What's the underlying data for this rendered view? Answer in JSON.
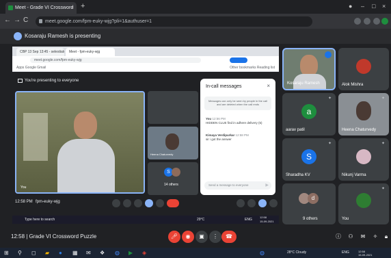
{
  "browser": {
    "tab_title": "Meet - Grade VI Crossword",
    "tab_close": "×",
    "new_tab": "+",
    "url": "meet.google.com/fpm-euky-wjg?pli=1&authuser=1",
    "back": "←",
    "forward": "→",
    "reload": "C",
    "min": "–",
    "max": "□",
    "close": "×"
  },
  "presenting_banner": "Kosaraju Ramesh is presenting",
  "shared_screen": {
    "tabs": [
      "CBP 13 Sep 13:45 - selestialcr...",
      "Meet - fpm-euky-wjg"
    ],
    "url": "meet.google.com/fpm-euky-wjg",
    "bookmarks": "Apps   Google   Gmail",
    "bookmarks_right": "Other bookmarks     Reading list",
    "presenting_text": "You're presenting to everyone",
    "main_name": "You",
    "small_tile_name": "Heena Chaturvedy",
    "others_label": "14 others",
    "time": "12:58 PM",
    "meet_code": "fpm-euky-wjg",
    "search_placeholder": "Type here to search",
    "taskbar_weather": "29°C",
    "taskbar_time": "12:58",
    "taskbar_date": "15-09-2021",
    "taskbar_lang": "ENG"
  },
  "chat": {
    "title": "In-call messages",
    "close": "×",
    "note": "Messages can only be seen by people in the call and are deleted when the call ends",
    "messages": [
      {
        "sender": "You",
        "time": "12:56 PM",
        "text": "HIDDEN CLUE find in adhere delivery (5)"
      },
      {
        "sender": "Kimaya Verdipurkar",
        "time": "12:58 PM",
        "text": "sir i got the answer"
      }
    ],
    "input_placeholder": "Send a message to everyone"
  },
  "participants": [
    {
      "name": "Kosaraju Ramesh",
      "type": "video"
    },
    {
      "name": "Alok Mishra",
      "type": "avatar-photo"
    },
    {
      "name": "aarav patil",
      "type": "letter",
      "letter": "a",
      "color": "#1e8e3e"
    },
    {
      "name": "Heena Chaturvedy",
      "type": "video"
    },
    {
      "name": "Sharadha KV",
      "type": "letter",
      "letter": "S",
      "color": "#1a73e8"
    },
    {
      "name": "Nikunj Varma",
      "type": "avatar-photo"
    },
    {
      "name": "9 others",
      "type": "group"
    },
    {
      "name": "You",
      "type": "avatar-photo"
    }
  ],
  "bottom": {
    "meeting_title": "12:58  |  Grade VI Crossword Puzzle"
  },
  "win_taskbar": {
    "weather": "28°C  Cloudy",
    "lang": "ENG",
    "time": "12:58",
    "date": "15-09-2021"
  },
  "colors": {
    "end_call": "#ea4335",
    "mic_off": "#ea4335",
    "accent": "#8ab4f8"
  }
}
